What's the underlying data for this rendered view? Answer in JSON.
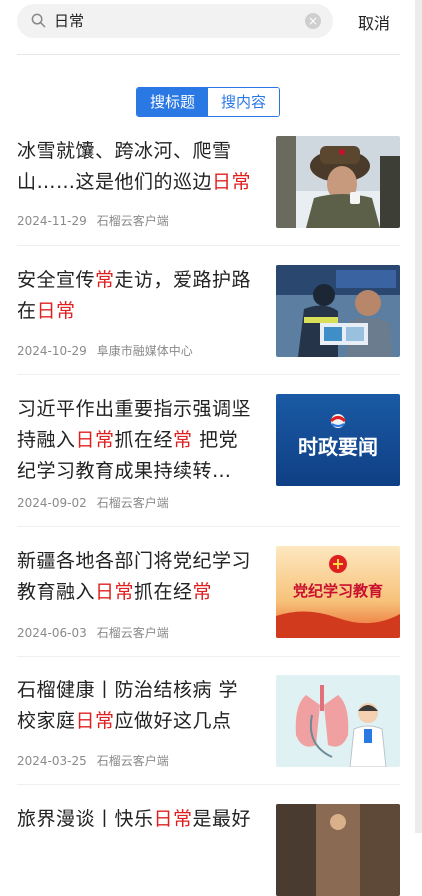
{
  "search": {
    "query": "日常",
    "cancel_label": "取消"
  },
  "tabs": [
    {
      "label": "搜标题",
      "active": true
    },
    {
      "label": "搜内容",
      "active": false
    }
  ],
  "colors": {
    "accent": "#2a78e4",
    "highlight": "#e02020"
  },
  "results": [
    {
      "title_parts": [
        [
          "冰雪就馕、跨冰河、爬雪山……这是他们的巡边",
          false
        ],
        [
          "日常",
          true
        ]
      ],
      "date": "2024-11-29",
      "source": "石榴云客户端",
      "thumb": "patrol-soldier-image"
    },
    {
      "title_parts": [
        [
          "安全宣传",
          false
        ],
        [
          "常",
          true
        ],
        [
          "走访，爱路护路在",
          false
        ],
        [
          "日常",
          true
        ]
      ],
      "date": "2024-10-29",
      "source": "阜康市融媒体中心",
      "thumb": "safety-outreach-image"
    },
    {
      "title_parts": [
        [
          "习近平作出重要指示强调坚持融入",
          false
        ],
        [
          "日常",
          true
        ],
        [
          "抓在经",
          false
        ],
        [
          "常",
          true
        ],
        [
          " 把党纪学习教育成果持续转…",
          false
        ]
      ],
      "date": "2024-09-02",
      "source": "石榴云客户端",
      "thumb": "news-banner-image",
      "thumb_text": "时政要闻"
    },
    {
      "title_parts": [
        [
          "新疆各地各部门将党纪学习教育融入",
          false
        ],
        [
          "日常",
          true
        ],
        [
          "抓在经",
          false
        ],
        [
          "常",
          true
        ]
      ],
      "date": "2024-06-03",
      "source": "石榴云客户端",
      "thumb": "party-discipline-banner-image",
      "thumb_text": "党纪学习教育"
    },
    {
      "title_parts": [
        [
          "石榴健康丨防治结核病 学校家庭",
          false
        ],
        [
          "日常",
          true
        ],
        [
          "应做好这几点",
          false
        ]
      ],
      "date": "2024-03-25",
      "source": "石榴云客户端",
      "thumb": "doctor-lungs-illustration"
    },
    {
      "title_parts": [
        [
          "旅界漫谈丨快乐",
          false
        ],
        [
          "日常",
          true
        ],
        [
          "是最好",
          false
        ]
      ],
      "date": "",
      "source": "",
      "thumb": "travel-image"
    }
  ]
}
